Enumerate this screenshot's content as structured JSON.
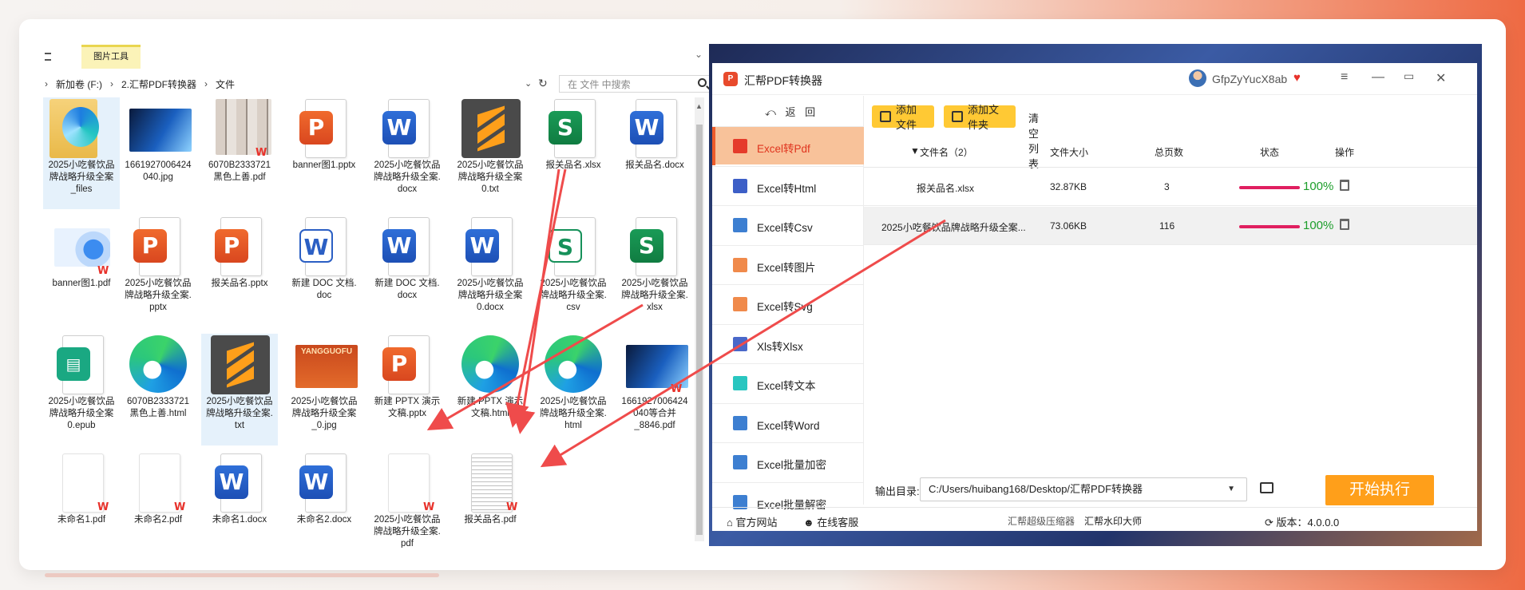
{
  "explorer": {
    "ribbon_tab": "图片工具",
    "breadcrumb": [
      "新加卷 (F:)",
      "2.汇帮PDF转换器",
      "文件"
    ],
    "search_placeholder": "在 文件 中搜索",
    "files": [
      {
        "label": "2025小吃餐饮品\n牌战略升级全案\n_files",
        "kind": "folder"
      },
      {
        "label": "1661927006424\n040.jpg",
        "kind": "photo-blue"
      },
      {
        "label": "6070B2333721\n黑色上善.pdf",
        "kind": "photo-collage"
      },
      {
        "label": "banner图1.pptx",
        "kind": "ppt"
      },
      {
        "label": "2025小吃餐饮品\n牌战略升级全案.\ndocx",
        "kind": "word"
      },
      {
        "label": "2025小吃餐饮品\n牌战略升级全案\n0.txt",
        "kind": "sublime"
      },
      {
        "label": "报关品名.xlsx",
        "kind": "xls"
      },
      {
        "label": "报关品名.docx",
        "kind": "word"
      },
      {
        "label": "banner图1.pdf",
        "kind": "ie-pdf"
      },
      {
        "label": "2025小吃餐饮品\n牌战略升级全案.\npptx",
        "kind": "ppt"
      },
      {
        "label": "报关品名.pptx",
        "kind": "ppt"
      },
      {
        "label": "新建 DOC 文档.\ndoc",
        "kind": "word-old"
      },
      {
        "label": "新建 DOC 文档.\ndocx",
        "kind": "word"
      },
      {
        "label": "2025小吃餐饮品\n牌战略升级全案\n0.docx",
        "kind": "word"
      },
      {
        "label": "2025小吃餐饮品\n牌战略升级全案.\ncsv",
        "kind": "csv"
      },
      {
        "label": "2025小吃餐饮品\n牌战略升级全案.\nxlsx",
        "kind": "xls"
      },
      {
        "label": "2025小吃餐饮品\n牌战略升级全案\n0.epub",
        "kind": "epub"
      },
      {
        "label": "6070B2333721\n黑色上善.html",
        "kind": "edge"
      },
      {
        "label": "2025小吃餐饮品\n牌战略升级全案.\ntxt",
        "kind": "sublime"
      },
      {
        "label": "2025小吃餐饮品\n牌战略升级全案\n_0.jpg",
        "kind": "photo-red"
      },
      {
        "label": "新建 PPTX 演示\n文稿.pptx",
        "kind": "ppt"
      },
      {
        "label": "新建 PPTX 演示\n文稿.html",
        "kind": "edge"
      },
      {
        "label": "2025小吃餐饮品\n牌战略升级全案.\nhtml",
        "kind": "edge"
      },
      {
        "label": "1661927006424\n040等合并\n_8846.pdf",
        "kind": "photo-blue-pdf"
      },
      {
        "label": "未命名1.pdf",
        "kind": "blank-pdf"
      },
      {
        "label": "未命名2.pdf",
        "kind": "blank-pdf"
      },
      {
        "label": "未命名1.docx",
        "kind": "word"
      },
      {
        "label": "未命名2.docx",
        "kind": "word"
      },
      {
        "label": "2025小吃餐饮品\n牌战略升级全案.\npdf",
        "kind": "blank-pdf"
      },
      {
        "label": "报关品名.pdf",
        "kind": "text-pdf"
      }
    ],
    "photo_red_text": "YANGGUOFU"
  },
  "converter": {
    "app_title": "汇帮PDF转换器",
    "user_name": "GfpZyYucX8ab",
    "back_label": "返 回",
    "nav": [
      {
        "label": "Excel转Pdf",
        "color": "#e53b2a",
        "active": true
      },
      {
        "label": "Excel转Html",
        "color": "#3d5fc7",
        "active": false
      },
      {
        "label": "Excel转Csv",
        "color": "#3d7fd1",
        "active": false
      },
      {
        "label": "Excel转图片",
        "color": "#f08a4b",
        "active": false
      },
      {
        "label": "Excel转Svg",
        "color": "#f08a4b",
        "active": false
      },
      {
        "label": "Xls转Xlsx",
        "color": "#4a68c9",
        "active": false
      },
      {
        "label": "Excel转文本",
        "color": "#29c6c0",
        "active": false
      },
      {
        "label": "Excel转Word",
        "color": "#3d7fd1",
        "active": false
      },
      {
        "label": "Excel批量加密",
        "color": "#3d7fd1",
        "active": false
      },
      {
        "label": "Excel批量解密",
        "color": "#3d7fd1",
        "active": false
      }
    ],
    "toolbar": {
      "add_file": "添加文件",
      "add_folder": "添加文件夹",
      "clear": "清空列表"
    },
    "table": {
      "headers": {
        "name": "文件名（2）",
        "size": "文件大小",
        "pages": "总页数",
        "status": "状态",
        "action": "操作"
      },
      "rows": [
        {
          "name": "报关品名.xlsx",
          "size": "32.87KB",
          "pages": "3",
          "progress": "100%"
        },
        {
          "name": "2025小吃餐饮品牌战略升级全案...",
          "size": "73.06KB",
          "pages": "116",
          "progress": "100%"
        }
      ]
    },
    "output": {
      "label": "输出目录:",
      "path": "C:/Users/huibang168/Desktop/汇帮PDF转换器"
    },
    "start_label": "开始执行",
    "footer": {
      "website": "官方网站",
      "support": "在线客服",
      "promo1": "汇帮超级压缩器",
      "promo2": "汇帮水印大师",
      "version": "版本：4.0.0.0"
    },
    "colors": {
      "accent": "#ff9f1a",
      "active_nav": "#f8c29a",
      "progress": "#e01f60",
      "percent": "#1d9e2b"
    }
  }
}
